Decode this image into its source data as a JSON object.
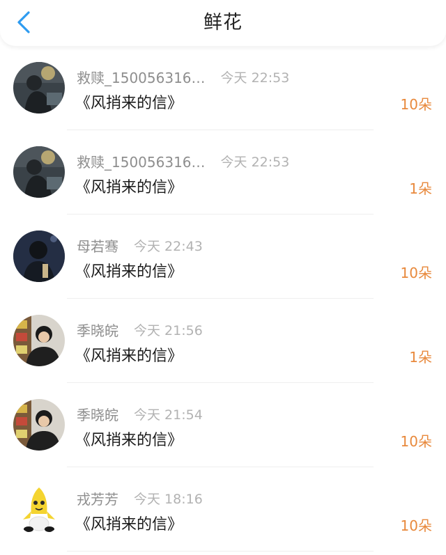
{
  "header": {
    "title": "鲜花",
    "back_icon": "chevron-left-icon",
    "accent_color": "#2e9bf0"
  },
  "colors": {
    "count": "#e8893c",
    "name": "#8e8e8e",
    "time": "#b2b2b2"
  },
  "gifts": [
    {
      "name": "救赎_150056316…",
      "time": "今天 22:53",
      "book": "《风捎来的信》",
      "count": "10朵",
      "avatar": "dark-photo-avatar"
    },
    {
      "name": "救赎_150056316…",
      "time": "今天 22:53",
      "book": "《风捎来的信》",
      "count": "1朵",
      "avatar": "dark-photo-avatar"
    },
    {
      "name": "母若骞",
      "time": "今天 22:43",
      "book": "《风捎来的信》",
      "count": "10朵",
      "avatar": "night-portrait-avatar"
    },
    {
      "name": "季晓皖",
      "time": "今天 21:56",
      "book": "《风捎来的信》",
      "count": "1朵",
      "avatar": "person-portrait-avatar"
    },
    {
      "name": "季晓皖",
      "time": "今天 21:54",
      "book": "《风捎来的信》",
      "count": "10朵",
      "avatar": "person-portrait-avatar"
    },
    {
      "name": "戎芳芳",
      "time": "今天 18:16",
      "book": "《风捎来的信》",
      "count": "10朵",
      "avatar": "banana-character-avatar"
    }
  ]
}
